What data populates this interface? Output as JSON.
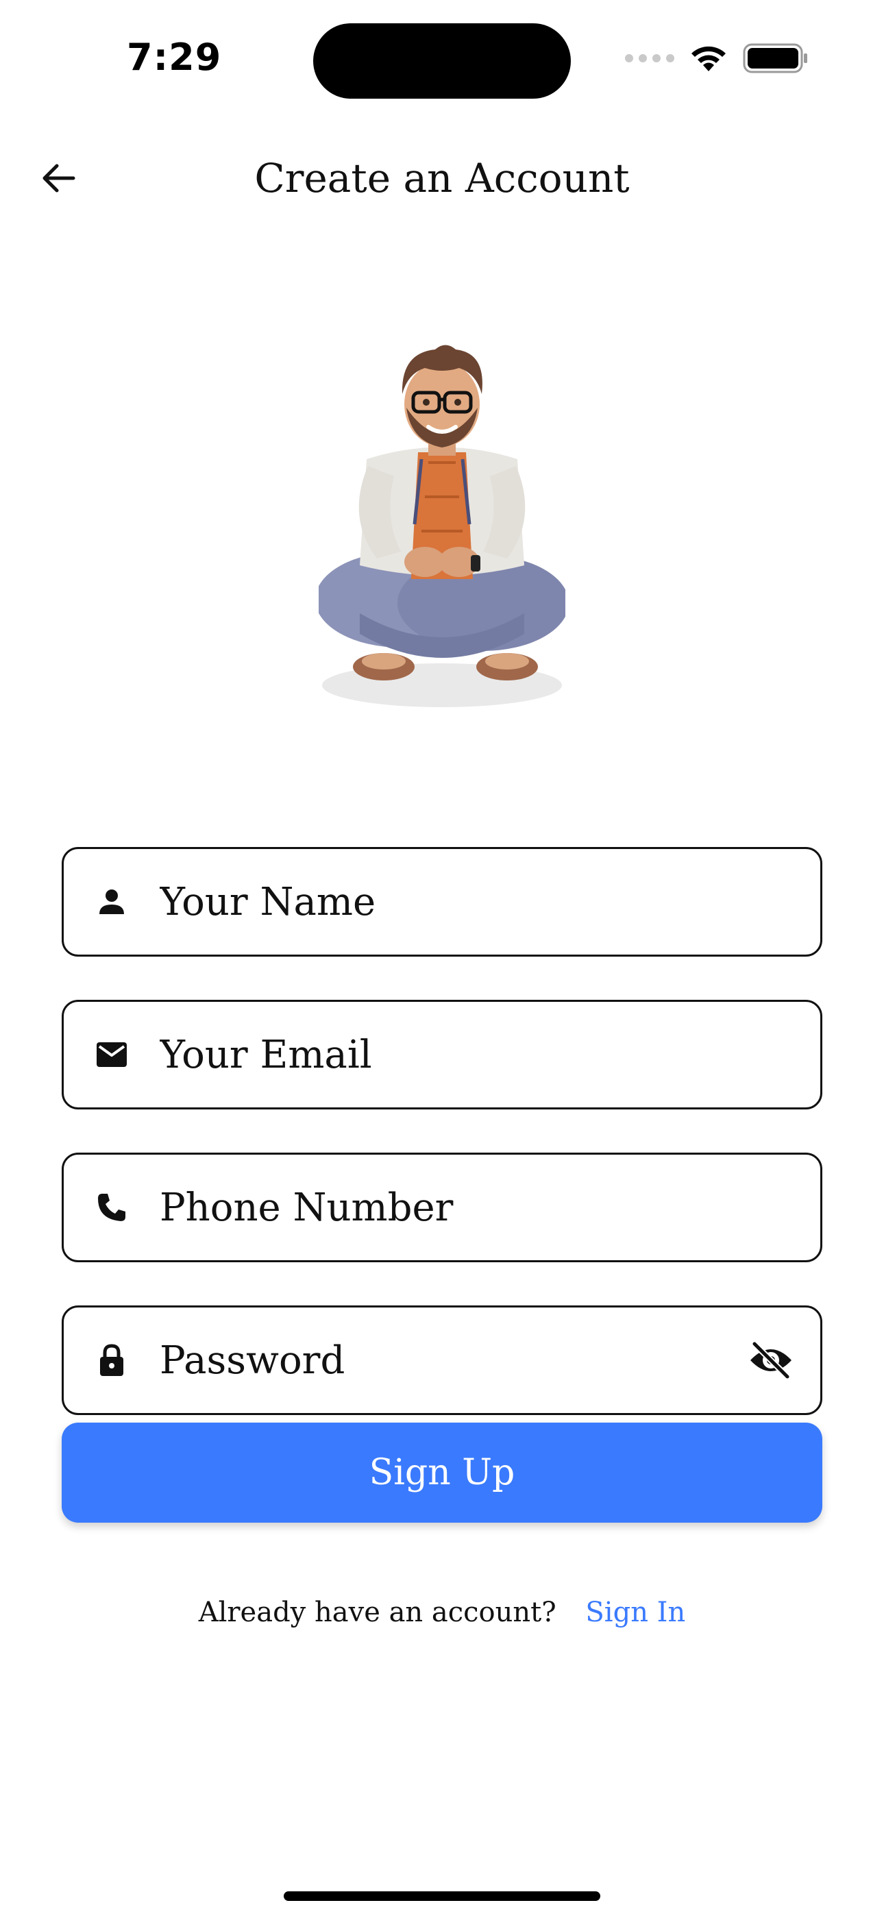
{
  "status_bar": {
    "time": "7:29"
  },
  "header": {
    "title": "Create an Account",
    "back_icon": "arrow-left-icon"
  },
  "avatar": {
    "description_icon": "user-avatar"
  },
  "form": {
    "name": {
      "placeholder": "Your Name",
      "icon": "person-icon"
    },
    "email": {
      "placeholder": "Your Email",
      "icon": "mail-icon"
    },
    "phone": {
      "placeholder": "Phone Number",
      "icon": "phone-icon"
    },
    "password": {
      "placeholder": "Password",
      "icon": "lock-icon",
      "toggle_icon": "eye-off-icon"
    },
    "submit_label": "Sign Up"
  },
  "footer": {
    "prompt": "Already have an account?",
    "link": "Sign In"
  },
  "colors": {
    "accent": "#3a7afe",
    "text": "#111111",
    "background": "#ffffff"
  }
}
